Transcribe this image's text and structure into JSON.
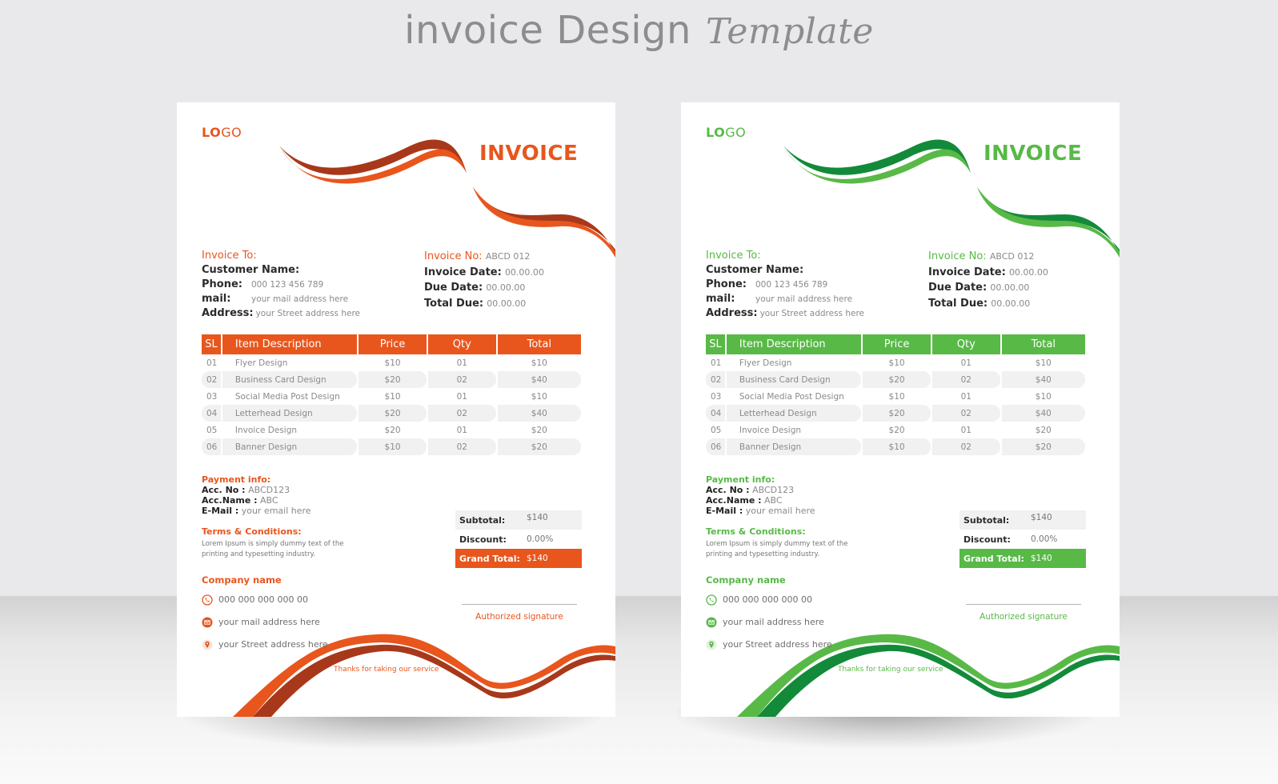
{
  "banner": {
    "title_main": "invoice Design",
    "title_script": "Template"
  },
  "invoices": [
    {
      "theme": "orange",
      "accent": "#e8561d",
      "accent_dark": "#a8381a",
      "logo": {
        "bold": "LO",
        "light": "GO"
      },
      "title": "INVOICE",
      "bill_to": {
        "heading": "Invoice To:",
        "customer_label": "Customer Name:",
        "phone_label": "Phone:",
        "phone_value": "000 123 456 789",
        "mail_label": "mail:",
        "mail_value": "your mail address here",
        "address_label": "Address:",
        "address_value": "your Street address here"
      },
      "meta": {
        "invoice_no_label": "Invoice No:",
        "invoice_no_value": "ABCD 012",
        "invoice_date_label": "Invoice Date:",
        "invoice_date_value": "00.00.00",
        "due_date_label": "Due Date:",
        "due_date_value": "00.00.00",
        "total_due_label": "Total Due:",
        "total_due_value": "00.00.00"
      },
      "table": {
        "headers": [
          "SL",
          "Item Description",
          "Price",
          "Qty",
          "Total"
        ],
        "rows": [
          [
            "01",
            "Flyer Design",
            "$10",
            "01",
            "$10"
          ],
          [
            "02",
            "Business Card Design",
            "$20",
            "02",
            "$40"
          ],
          [
            "03",
            "Social Media Post Design",
            "$10",
            "01",
            "$10"
          ],
          [
            "04",
            "Letterhead Design",
            "$20",
            "02",
            "$40"
          ],
          [
            "05",
            "Invoice Design",
            "$20",
            "01",
            "$20"
          ],
          [
            "06",
            "Banner Design",
            "$10",
            "02",
            "$20"
          ]
        ]
      },
      "payment": {
        "heading": "Payment info:",
        "acc_no_label": "Acc. No :",
        "acc_no_value": "ABCD123",
        "acc_name_label": "Acc.Name :",
        "acc_name_value": "ABC",
        "email_label": "E-Mail :",
        "email_value": "your email here"
      },
      "terms": {
        "heading": "Terms & Conditions:",
        "body": "Lorem Ipsum is simply dummy text of the printing and typesetting industry."
      },
      "company": {
        "heading": "Company name",
        "phone": "000 000 000 000 00",
        "mail": "your mail address here",
        "address": "your Street address here",
        "icons": [
          "phone-icon",
          "mail-icon",
          "location-pin-icon"
        ]
      },
      "totals": {
        "subtotal_label": "Subtotal:",
        "subtotal_value": "$140",
        "discount_label": "Discount:",
        "discount_value": "0.00%",
        "grand_label": "Grand Total:",
        "grand_value": "$140"
      },
      "signature_label": "Authorized signature",
      "footer_note": "Thanks for taking our service"
    },
    {
      "theme": "green",
      "accent": "#58b947",
      "accent_dark": "#138a3a",
      "logo": {
        "bold": "LO",
        "light": "GO"
      },
      "title": "INVOICE",
      "bill_to": {
        "heading": "Invoice To:",
        "customer_label": "Customer Name:",
        "phone_label": "Phone:",
        "phone_value": "000 123 456 789",
        "mail_label": "mail:",
        "mail_value": "your mail address here",
        "address_label": "Address:",
        "address_value": "your Street address here"
      },
      "meta": {
        "invoice_no_label": "Invoice No:",
        "invoice_no_value": "ABCD 012",
        "invoice_date_label": "Invoice Date:",
        "invoice_date_value": "00.00.00",
        "due_date_label": "Due Date:",
        "due_date_value": "00.00.00",
        "total_due_label": "Total Due:",
        "total_due_value": "00.00.00"
      },
      "table": {
        "headers": [
          "SL",
          "Item Description",
          "Price",
          "Qty",
          "Total"
        ],
        "rows": [
          [
            "01",
            "Flyer Design",
            "$10",
            "01",
            "$10"
          ],
          [
            "02",
            "Business Card Design",
            "$20",
            "02",
            "$40"
          ],
          [
            "03",
            "Social Media Post Design",
            "$10",
            "01",
            "$10"
          ],
          [
            "04",
            "Letterhead Design",
            "$20",
            "02",
            "$40"
          ],
          [
            "05",
            "Invoice Design",
            "$20",
            "01",
            "$20"
          ],
          [
            "06",
            "Banner Design",
            "$10",
            "02",
            "$20"
          ]
        ]
      },
      "payment": {
        "heading": "Payment info:",
        "acc_no_label": "Acc. No :",
        "acc_no_value": "ABCD123",
        "acc_name_label": "Acc.Name :",
        "acc_name_value": "ABC",
        "email_label": "E-Mail :",
        "email_value": "your email here"
      },
      "terms": {
        "heading": "Terms & Conditions:",
        "body": "Lorem Ipsum is simply dummy text of the printing and typesetting industry."
      },
      "company": {
        "heading": "Company name",
        "phone": "000 000 000 000 00",
        "mail": "your mail address here",
        "address": "your Street address here",
        "icons": [
          "phone-icon",
          "mail-icon",
          "location-pin-icon"
        ]
      },
      "totals": {
        "subtotal_label": "Subtotal:",
        "subtotal_value": "$140",
        "discount_label": "Discount:",
        "discount_value": "0.00%",
        "grand_label": "Grand Total:",
        "grand_value": "$140"
      },
      "signature_label": "Authorized signature",
      "footer_note": "Thanks for taking our service"
    }
  ]
}
